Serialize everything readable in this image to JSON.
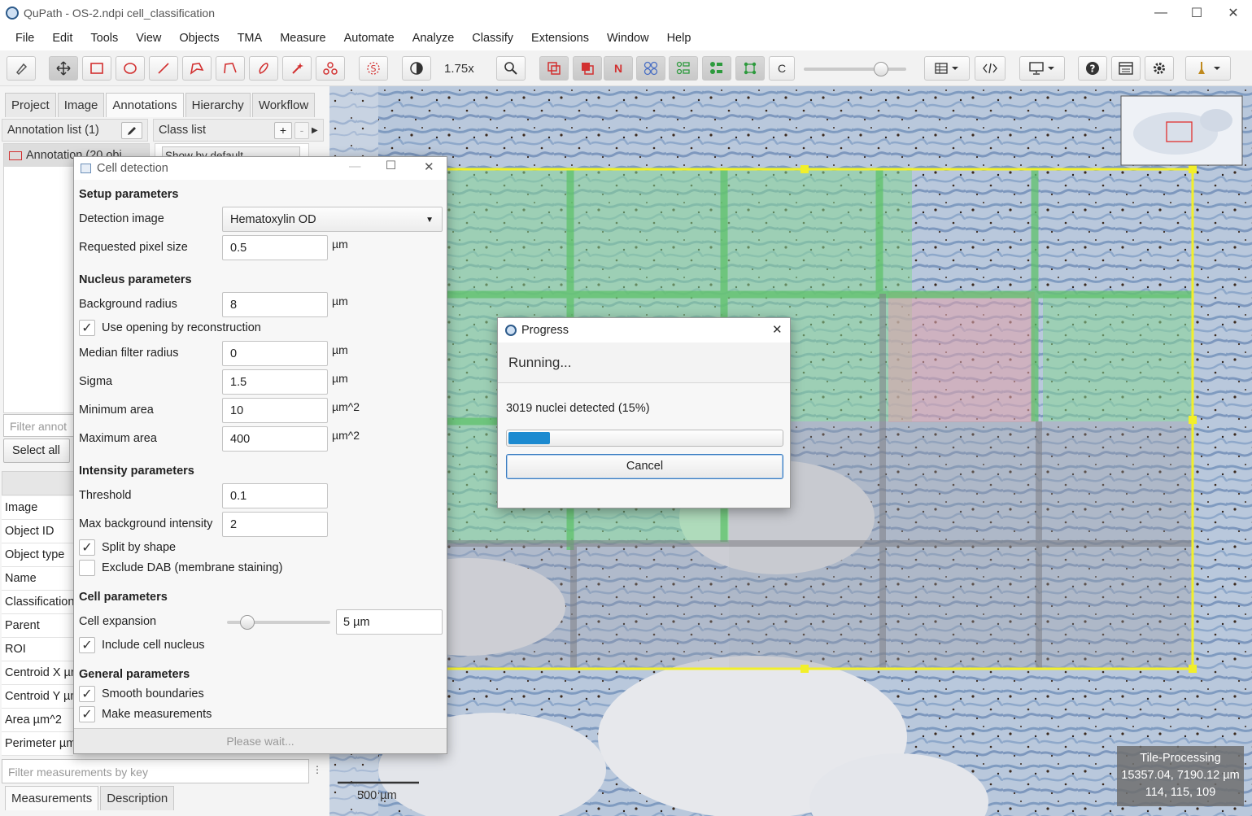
{
  "window": {
    "title": "QuPath - OS-2.ndpi cell_classification"
  },
  "menu": [
    "File",
    "Edit",
    "Tools",
    "View",
    "Objects",
    "TMA",
    "Measure",
    "Automate",
    "Analyze",
    "Classify",
    "Extensions",
    "Window",
    "Help"
  ],
  "toolbar": {
    "zoom": "1.75x",
    "classify_letter": "C",
    "normal_letter": "N"
  },
  "tabs": [
    "Project",
    "Image",
    "Annotations",
    "Hierarchy",
    "Workflow"
  ],
  "annotations": {
    "list_header": "Annotation list (1)",
    "item": "Annotation (20 obj",
    "filter_placeholder": "Filter annot",
    "select_all": "Select all",
    "class_list_header": "Class list",
    "show_by_default": "Show by default"
  },
  "properties": [
    "Image",
    "Object ID",
    "Object type",
    "Name",
    "Classification",
    "Parent",
    "ROI",
    "Centroid X µm",
    "Centroid Y µm",
    "Area µm^2",
    "Perimeter µm"
  ],
  "bottom": {
    "filter_placeholder": "Filter measurements by key",
    "tabs": [
      "Measurements",
      "Description"
    ]
  },
  "viewer": {
    "scalebar": "500 µm",
    "overlay_title": "Tile-Processing",
    "overlay_coords": "15357.04, 7190.12 µm",
    "overlay_rgb": "114, 115, 109"
  },
  "cell_detection": {
    "title": "Cell detection",
    "setup_header": "Setup parameters",
    "detection_image_label": "Detection image",
    "detection_image_value": "Hematoxylin OD",
    "pixel_size_label": "Requested pixel size",
    "pixel_size_value": "0.5",
    "unit_um": "µm",
    "unit_um2": "µm^2",
    "nucleus_header": "Nucleus parameters",
    "bg_radius_label": "Background radius",
    "bg_radius_value": "8",
    "opening_label": "Use opening by reconstruction",
    "median_label": "Median filter radius",
    "median_value": "0",
    "sigma_label": "Sigma",
    "sigma_value": "1.5",
    "min_area_label": "Minimum area",
    "min_area_value": "10",
    "max_area_label": "Maximum area",
    "max_area_value": "400",
    "intensity_header": "Intensity parameters",
    "threshold_label": "Threshold",
    "threshold_value": "0.1",
    "max_bg_label": "Max background intensity",
    "max_bg_value": "2",
    "split_label": "Split by shape",
    "exclude_dab_label": "Exclude DAB (membrane staining)",
    "cell_header": "Cell parameters",
    "expansion_label": "Cell expansion",
    "expansion_value": "5 µm",
    "expansion_slider_fraction": 0.2,
    "include_nucleus_label": "Include cell nucleus",
    "general_header": "General parameters",
    "smooth_label": "Smooth boundaries",
    "measure_label": "Make measurements",
    "run_label": "Please wait..."
  },
  "progress": {
    "title": "Progress",
    "running": "Running...",
    "status": "3019 nuclei detected (15%)",
    "percent": 15,
    "cancel": "Cancel"
  },
  "colors": {
    "annotation": "#f2ef2a",
    "tile_done": "#7fd08a",
    "tile_active": "#d5a3aa",
    "accent": "#1c8ad0"
  }
}
